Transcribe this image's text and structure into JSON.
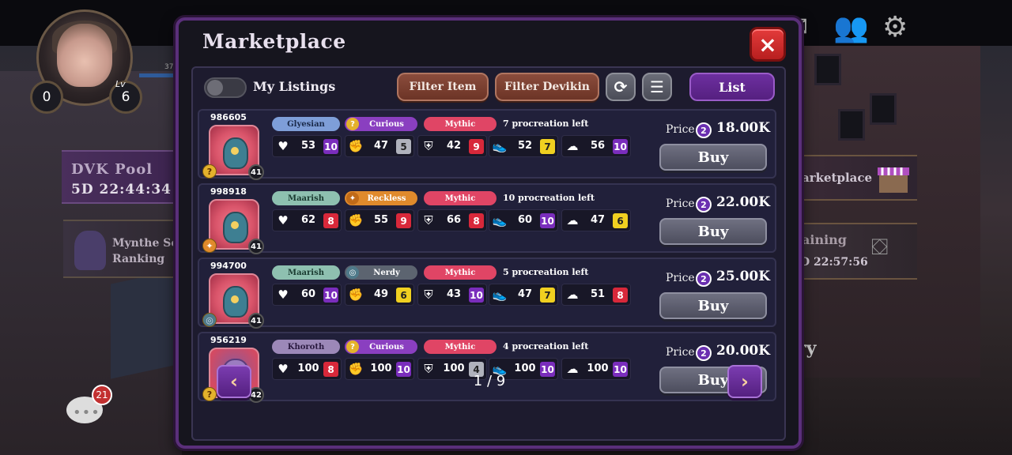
{
  "hud": {
    "gems": "0",
    "level_label": "Lv",
    "level": "6",
    "xp_text": "37",
    "pool_title": "DVK Pool",
    "pool_timer": "5D 22:44:34",
    "ranking_line1": "Mynthe Se",
    "ranking_line2": "Ranking",
    "chat_badge": "21",
    "marketplace_label": "arketplace",
    "training_label": "aining",
    "training_timer": "D 22:57:56",
    "bg_text": "ry"
  },
  "modal": {
    "title": "Marketplace",
    "close_icon": "×",
    "toolbar": {
      "my_listings": "My Listings",
      "filter_item": "Filter Item",
      "filter_devikin": "Filter Devikin",
      "refresh_icon": "⟳",
      "menu_icon": "☰",
      "list": "List"
    },
    "price_label": "Price",
    "coin_symbol": "2",
    "buy_label": "Buy",
    "listings": [
      {
        "id": "986605",
        "level": "41",
        "species": "creature",
        "tribe": "Glyesian",
        "tribe_color": "#7e9ed8",
        "tribe_text": "#1a2a4a",
        "trait": "Curious",
        "trait_color": "#8a3fc0",
        "trait_icon": "?",
        "trait_icon_bg": "#e4b22c",
        "rarity": "Mythic",
        "procreation": "7 procreation left",
        "stats": [
          {
            "value": "53",
            "grade": "10",
            "grade_bg": "#7a2dbc"
          },
          {
            "value": "47",
            "grade": "5",
            "grade_bg": "#b0b2bc"
          },
          {
            "value": "42",
            "grade": "9",
            "grade_bg": "#d8283a"
          },
          {
            "value": "52",
            "grade": "7",
            "grade_bg": "#f0d020"
          },
          {
            "value": "56",
            "grade": "10",
            "grade_bg": "#7a2dbc"
          }
        ],
        "price": "18.00K",
        "mini_icon": "?",
        "mini_style": ""
      },
      {
        "id": "998918",
        "level": "41",
        "species": "creature",
        "tribe": "Maarish",
        "tribe_color": "#8ec0b0",
        "tribe_text": "#1a3a30",
        "trait": "Reckless",
        "trait_color": "#e08a2c",
        "trait_icon": "✦",
        "trait_icon_bg": "#c06a18",
        "rarity": "Mythic",
        "procreation": "10 procreation left",
        "stats": [
          {
            "value": "62",
            "grade": "8",
            "grade_bg": "#d8283a"
          },
          {
            "value": "55",
            "grade": "9",
            "grade_bg": "#d8283a"
          },
          {
            "value": "66",
            "grade": "8",
            "grade_bg": "#d8283a"
          },
          {
            "value": "60",
            "grade": "10",
            "grade_bg": "#7a2dbc"
          },
          {
            "value": "47",
            "grade": "6",
            "grade_bg": "#f0d020"
          }
        ],
        "price": "22.00K",
        "mini_icon": "✦",
        "mini_style": "orange"
      },
      {
        "id": "994700",
        "level": "41",
        "species": "creature",
        "tribe": "Maarish",
        "tribe_color": "#8ec0b0",
        "tribe_text": "#1a3a30",
        "trait": "Nerdy",
        "trait_color": "#5c6470",
        "trait_icon": "◎",
        "trait_icon_bg": "#4f7a8a",
        "rarity": "Mythic",
        "procreation": "5 procreation left",
        "stats": [
          {
            "value": "60",
            "grade": "10",
            "grade_bg": "#7a2dbc"
          },
          {
            "value": "49",
            "grade": "6",
            "grade_bg": "#f0d020"
          },
          {
            "value": "43",
            "grade": "10",
            "grade_bg": "#7a2dbc"
          },
          {
            "value": "47",
            "grade": "7",
            "grade_bg": "#f0d020"
          },
          {
            "value": "51",
            "grade": "8",
            "grade_bg": "#d8283a"
          }
        ],
        "price": "25.00K",
        "mini_icon": "◎",
        "mini_style": "gray"
      },
      {
        "id": "956219",
        "level": "42",
        "species": "khoroth",
        "tribe": "Khoroth",
        "tribe_color": "#9c88b8",
        "tribe_text": "#2a1a40",
        "trait": "Curious",
        "trait_color": "#8a3fc0",
        "trait_icon": "?",
        "trait_icon_bg": "#e4b22c",
        "rarity": "Mythic",
        "procreation": "4 procreation left",
        "stats": [
          {
            "value": "100",
            "grade": "8",
            "grade_bg": "#d8283a"
          },
          {
            "value": "100",
            "grade": "10",
            "grade_bg": "#7a2dbc"
          },
          {
            "value": "100",
            "grade": "4",
            "grade_bg": "#b0b2bc"
          },
          {
            "value": "100",
            "grade": "10",
            "grade_bg": "#7a2dbc"
          },
          {
            "value": "100",
            "grade": "10",
            "grade_bg": "#7a2dbc"
          }
        ],
        "price": "20.00K",
        "mini_icon": "?",
        "mini_style": ""
      }
    ],
    "stat_icons": [
      "♥",
      "✊",
      "⛨",
      "👟",
      "☁"
    ],
    "stat_names": [
      "health-icon",
      "attack-icon",
      "defense-icon",
      "speed-icon",
      "spirit-icon"
    ],
    "pagination": {
      "prev_icon": "‹",
      "next_icon": "›",
      "label": "1 / 9"
    }
  }
}
